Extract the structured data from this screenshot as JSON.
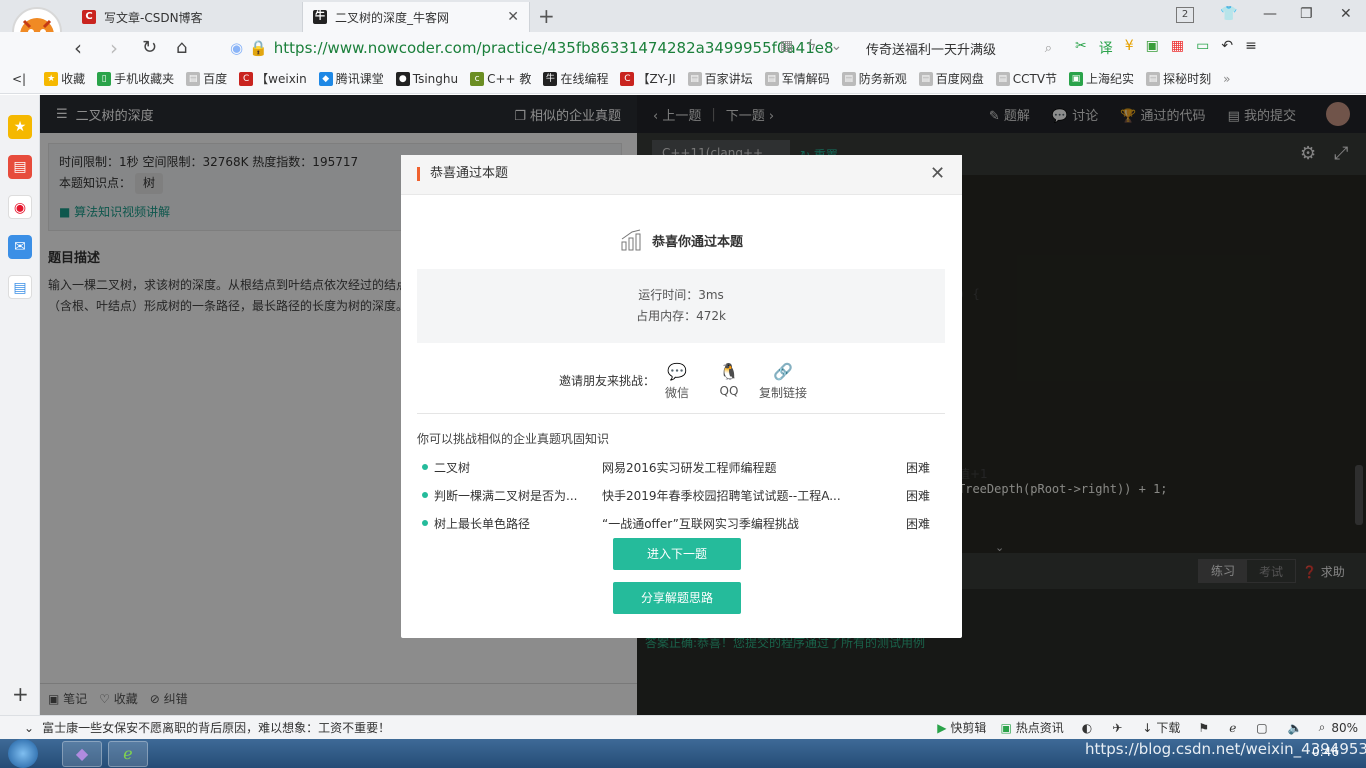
{
  "browser": {
    "tabs": [
      {
        "title": "写文章-CSDN博客",
        "icon": "csdn-icon"
      },
      {
        "title": "二叉树的深度_牛客网",
        "icon": "nowcoder-icon"
      }
    ],
    "tab_counter": "2",
    "url": "https://www.nowcoder.com/practice/435fb86331474282a3499955f0a41e8",
    "search_text": "传奇送福利一天升满级",
    "bookmarks": [
      "收藏",
      "手机收藏夹",
      "百度",
      "【weixin",
      "腾讯课堂",
      "Tsinghu",
      "C++ 教",
      "在线编程",
      "【ZY-JI",
      "百家讲坛",
      "军情解码",
      "防务新观",
      "百度网盘",
      "CCTV节",
      "上海纪实",
      "探秘时刻"
    ]
  },
  "problem": {
    "header_title": "二叉树的深度",
    "similar_link": "相似的企业真题",
    "meta_line": "时间限制：1秒   空间限制：32768K   热度指数：195717",
    "knowledge_label": "本题知识点：",
    "knowledge_tag": "树",
    "video_link": "算法知识视频讲解",
    "desc_title": "题目描述",
    "desc_text": "输入一棵二叉树，求该树的深度。从根结点到叶结点依次经过的结点（含根、叶结点）形成树的一条路径，最长路径的长度为树的深度。",
    "footer": {
      "note": "笔记",
      "collect": "收藏",
      "error": "纠错"
    }
  },
  "editor": {
    "prev": "上一题",
    "next": "下一题",
    "solution": "题解",
    "discuss": "讨论",
    "passed_code": "通过的代码",
    "my_submit": "我的提交",
    "lang": "C++11(clang++ 3.9)",
    "reset": "重置",
    "code_faint": ") {",
    "code_line": "TreeDepth(pRoot->right)) + 1;",
    "code_faint2": "值+1",
    "mode_practice": "练习",
    "mode_exam": "考试",
    "help": "求助",
    "result": "答案正确:恭喜！您提交的程序通过了所有的测试用例"
  },
  "modal": {
    "title": "恭喜通过本题",
    "congrats": "恭喜你通过本题",
    "runtime": "运行时间：3ms",
    "memory": "占用内存：472k",
    "invite_label": "邀请朋友来挑战：",
    "share": [
      {
        "label": "微信",
        "icon": "wechat-icon"
      },
      {
        "label": "QQ",
        "icon": "qq-icon"
      },
      {
        "label": "复制链接",
        "icon": "link-icon"
      }
    ],
    "similar_title": "你可以挑战相似的企业真题巩固知识",
    "similar": [
      {
        "name": "二叉树",
        "source": "网易2016实习研发工程师编程题",
        "level": "困难"
      },
      {
        "name": "判断一棵满二叉树是否为...",
        "source": "快手2019年春季校园招聘笔试试题--工程A...",
        "level": "困难"
      },
      {
        "name": "树上最长单色路径",
        "source": "“一战通offer”互联网实习季编程挑战",
        "level": "困难"
      }
    ],
    "next_btn": "进入下一题",
    "share_btn": "分享解题思路"
  },
  "statusbar": {
    "news": "富士康一些女保安不愿离职的背后原因，难以想象：工资不重要！",
    "cut": "快剪辑",
    "hot": "热点资讯",
    "download": "下载",
    "zoom": "80%"
  },
  "taskbar": {
    "watermark": "https://blog.csdn.net/weixin_43949535",
    "time": "0:46"
  }
}
